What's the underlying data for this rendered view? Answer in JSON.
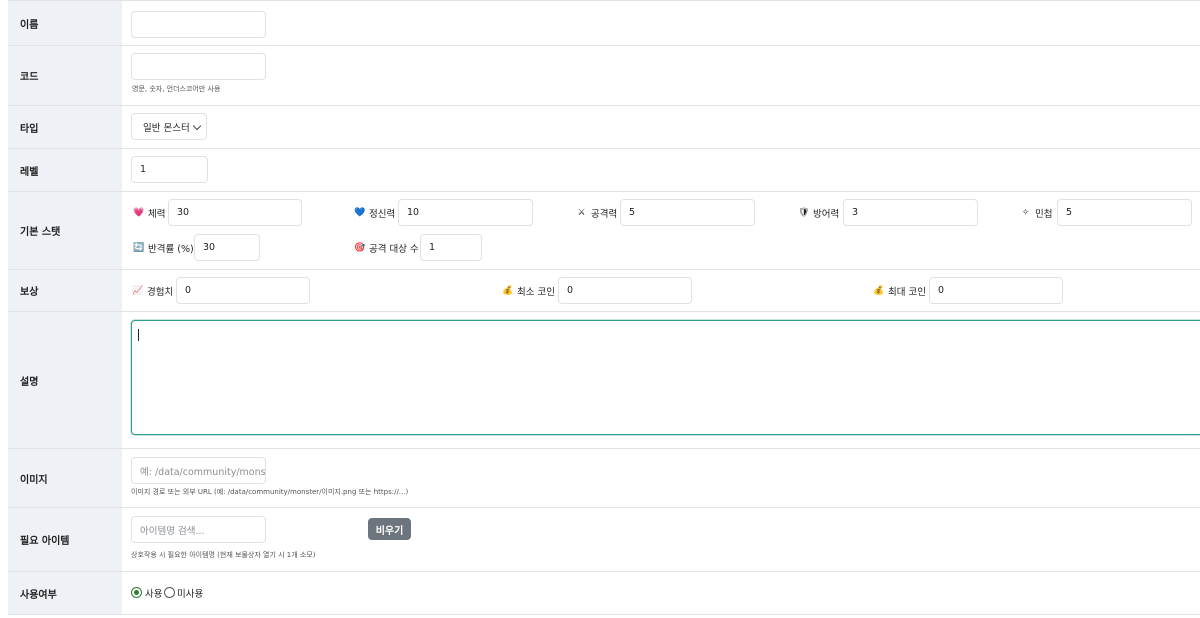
{
  "fields": {
    "name": {
      "label": "이름",
      "value": ""
    },
    "code": {
      "label": "코드",
      "value": "",
      "help": "영문, 숫자, 언더스코어만 사용"
    },
    "type": {
      "label": "타입",
      "selected": "일반 몬스터"
    },
    "level": {
      "label": "레벨",
      "value": "1"
    },
    "stats": {
      "label": "기본 스탯",
      "items": [
        {
          "icon": "heart-icon",
          "emoji": "💗",
          "label": "체력",
          "value": "30"
        },
        {
          "icon": "blue-heart-icon",
          "emoji": "💙",
          "label": "정신력",
          "value": "10"
        },
        {
          "icon": "crossed-swords-icon",
          "emoji": "⚔",
          "label": "공격력",
          "value": "5"
        },
        {
          "icon": "shield-icon",
          "emoji": "🛡",
          "label": "방어력",
          "value": "3"
        },
        {
          "icon": "sparkle-icon",
          "emoji": "✧",
          "label": "민첩",
          "value": "5"
        },
        {
          "icon": "counter-icon",
          "emoji": "🔄",
          "label": "반격률 (%)",
          "value": "30"
        },
        {
          "icon": "target-icon",
          "emoji": "🎯",
          "label": "공격 대상 수",
          "value": "1"
        }
      ]
    },
    "reward": {
      "label": "보상",
      "items": [
        {
          "icon": "chart-icon",
          "emoji": "📈",
          "label": "경험치",
          "value": "0"
        },
        {
          "icon": "money-bag-icon",
          "emoji": "💰",
          "label": "최소 코인",
          "value": "0"
        },
        {
          "icon": "money-bag-icon",
          "emoji": "💰",
          "label": "최대 코인",
          "value": "0"
        }
      ]
    },
    "description": {
      "label": "설명",
      "value": ""
    },
    "image": {
      "label": "이미지",
      "placeholder": "예: /data/community/monster/",
      "help": "이미지 경로 또는 외부 URL (예: /data/community/monster/이미지.png 또는 https://...)"
    },
    "required_item": {
      "label": "필요 아이템",
      "placeholder": "아이템명 검색...",
      "button": "비우기",
      "help": "상호작용 시 필요한 아이템명 (현재 보물상자 열기 시 1개 소모)"
    },
    "active": {
      "label": "사용여부",
      "options": [
        "사용",
        "미사용"
      ],
      "selected": "사용"
    }
  },
  "colors": {
    "label_bg": "#eef2f7",
    "border": "#dfe3e8",
    "focus": "#2a9d8f",
    "button": "#6c757d",
    "radio": "#2e7d32"
  }
}
